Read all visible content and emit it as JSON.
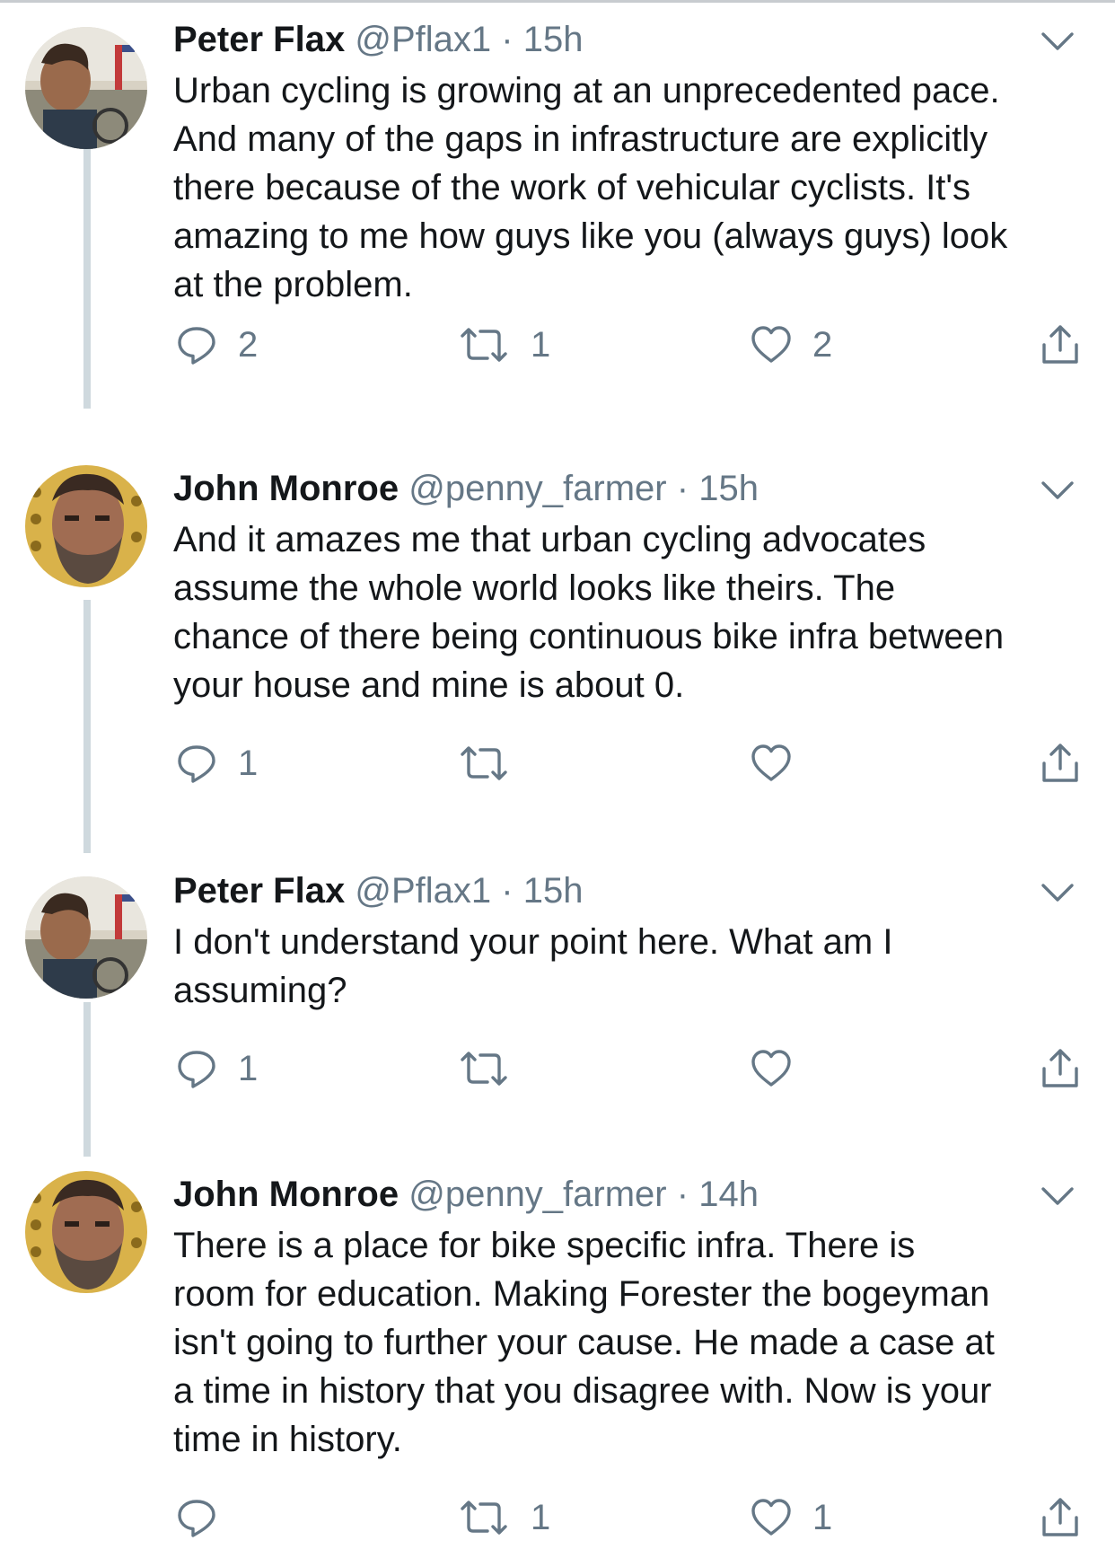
{
  "tweets": [
    {
      "name": "Peter Flax",
      "handle": "@Pflax1",
      "separator": "·",
      "time": "15h",
      "avatar": "peter-flax-avatar",
      "text": "Urban cycling is growing at an unprecedented pace.\nAnd many of the gaps in infrastructure are explicitly\nthere because of the work of vehicular cyclists. It's\namazing to me how guys like you (always guys) look\nat the problem.",
      "replies": "2",
      "retweets": "1",
      "likes": "2"
    },
    {
      "name": "John Monroe",
      "handle": "@penny_farmer",
      "separator": "·",
      "time": "15h",
      "avatar": "john-monroe-avatar",
      "text": "And it amazes me that urban cycling advocates\nassume the whole world looks like theirs.  The\nchance of there being continuous bike infra between\nyour house and mine is about 0.",
      "replies": "1",
      "retweets": "",
      "likes": ""
    },
    {
      "name": "Peter Flax",
      "handle": "@Pflax1",
      "separator": "·",
      "time": "15h",
      "avatar": "peter-flax-avatar",
      "text": "I don't understand your point here. What am I\nassuming?",
      "replies": "1",
      "retweets": "",
      "likes": ""
    },
    {
      "name": "John Monroe",
      "handle": "@penny_farmer",
      "separator": "·",
      "time": "14h",
      "avatar": "john-monroe-avatar",
      "text": "There is a place for bike specific infra.  There is\nroom for education. Making Forester the bogeyman\nisn't going to further your cause.  He made a case at\na time in history that you disagree with. Now is your\ntime in history.",
      "replies": "",
      "retweets": "1",
      "likes": "1"
    }
  ],
  "colors": {
    "text": "#14171a",
    "secondary": "#657786",
    "thread_line": "#cfd9de",
    "background": "#ffffff"
  },
  "icons": {
    "reply": "reply-icon",
    "retweet": "retweet-icon",
    "like": "heart-icon",
    "share": "share-icon",
    "menu": "chevron-down-icon"
  }
}
